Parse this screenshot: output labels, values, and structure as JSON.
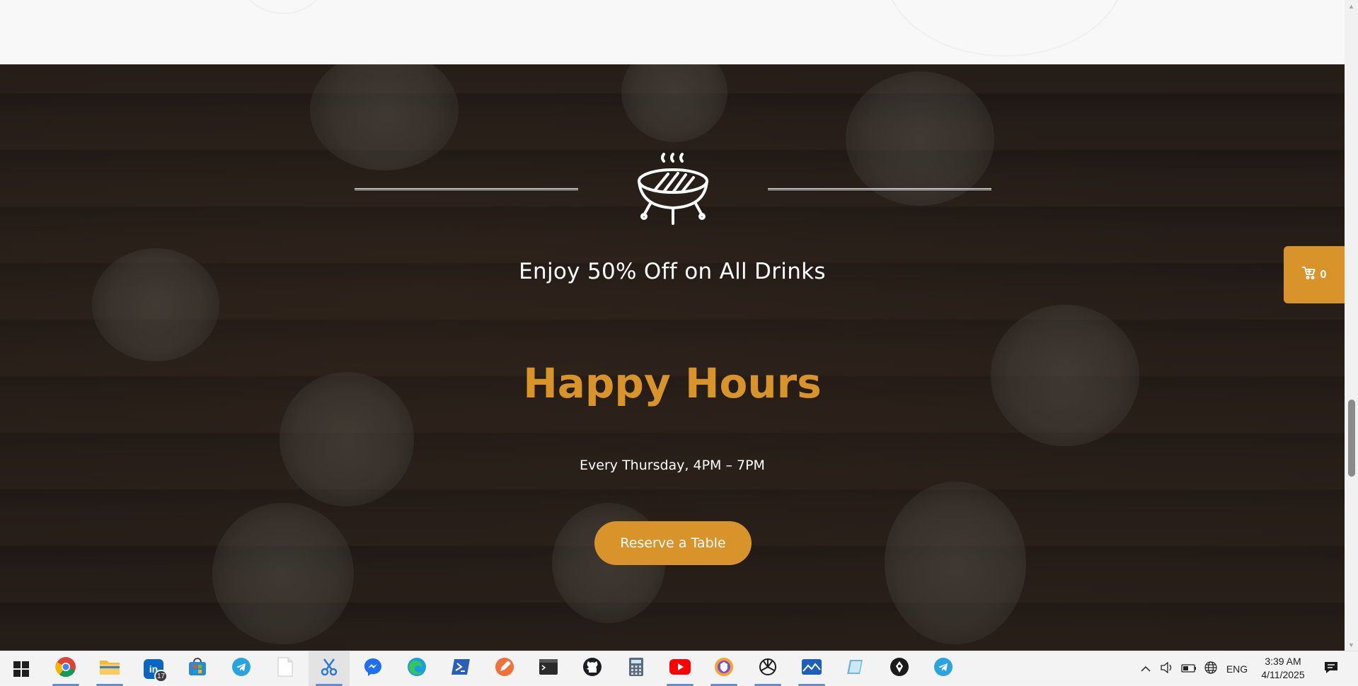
{
  "hero": {
    "offer": "Enjoy 50% Off on All Drinks",
    "title": "Happy Hours",
    "schedule": "Every Thursday, 4PM – 7PM",
    "reserve_label": "Reserve a Table",
    "grill_icon": "grill-icon"
  },
  "cart": {
    "icon": "cart-icon",
    "count": "0"
  },
  "colors": {
    "accent": "#d8932a",
    "title": "#d99429",
    "overlay": "#141212"
  },
  "taskbar": {
    "apps": [
      {
        "name": "start",
        "label": ""
      },
      {
        "name": "chrome",
        "label": ""
      },
      {
        "name": "file-explorer",
        "label": ""
      },
      {
        "name": "linkedin",
        "label": "in",
        "badge": "17"
      },
      {
        "name": "microsoft-store",
        "label": ""
      },
      {
        "name": "telegram",
        "label": ""
      },
      {
        "name": "notepad",
        "label": ""
      },
      {
        "name": "snipping-tool",
        "label": ""
      },
      {
        "name": "messenger",
        "label": ""
      },
      {
        "name": "edge",
        "label": ""
      },
      {
        "name": "powershell",
        "label": ""
      },
      {
        "name": "pen-app",
        "label": ""
      },
      {
        "name": "terminal",
        "label": ""
      },
      {
        "name": "github",
        "label": ""
      },
      {
        "name": "calculator",
        "label": ""
      },
      {
        "name": "youtube",
        "label": ""
      },
      {
        "name": "brave",
        "label": ""
      },
      {
        "name": "chatgpt",
        "label": ""
      },
      {
        "name": "mail-app",
        "label": ""
      },
      {
        "name": "reader-app",
        "label": ""
      },
      {
        "name": "pen-tool-app",
        "label": ""
      },
      {
        "name": "telegram-2",
        "label": ""
      }
    ],
    "tray": {
      "language": "ENG",
      "time": "3:39 AM",
      "date": "4/11/2025"
    }
  }
}
